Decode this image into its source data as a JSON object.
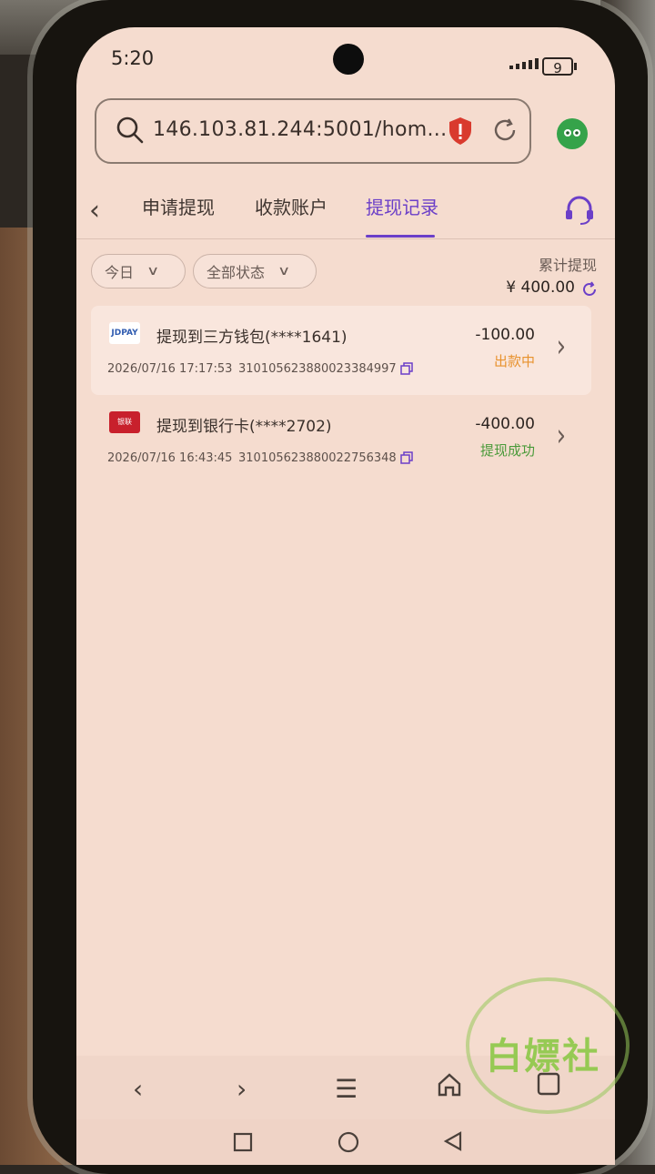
{
  "status": {
    "time": "5:20",
    "battery": "9"
  },
  "browser": {
    "url": "146.103.81.244:5001/hom..."
  },
  "tabs": [
    {
      "label": "申请提现"
    },
    {
      "label": "收款账户"
    },
    {
      "label": "提现记录",
      "active": true
    }
  ],
  "filters": {
    "date": "今日",
    "status": "全部状态"
  },
  "summary": {
    "label": "累计提现",
    "amount": "¥ 400.00"
  },
  "records": [
    {
      "method_icon": "jdpay-icon",
      "title": "提现到三方钱包(****1641)",
      "datetime": "2026/07/16 17:17:53",
      "order_no": "31010562388002338499​7",
      "amount": "-100.00",
      "status": "出款中",
      "status_color": "#e8922e"
    },
    {
      "method_icon": "unionpay-icon",
      "title": "提现到银行卡(****2702)",
      "datetime": "2026/07/16 16:43:45",
      "order_no": "310105623880022756348",
      "amount": "-400.00",
      "status": "提现成功",
      "status_color": "#4a9a3a"
    }
  ],
  "colors": {
    "accent": "#6b3fc8",
    "background": "#f5dccf"
  },
  "watermark": {
    "text": "白嫖社"
  }
}
